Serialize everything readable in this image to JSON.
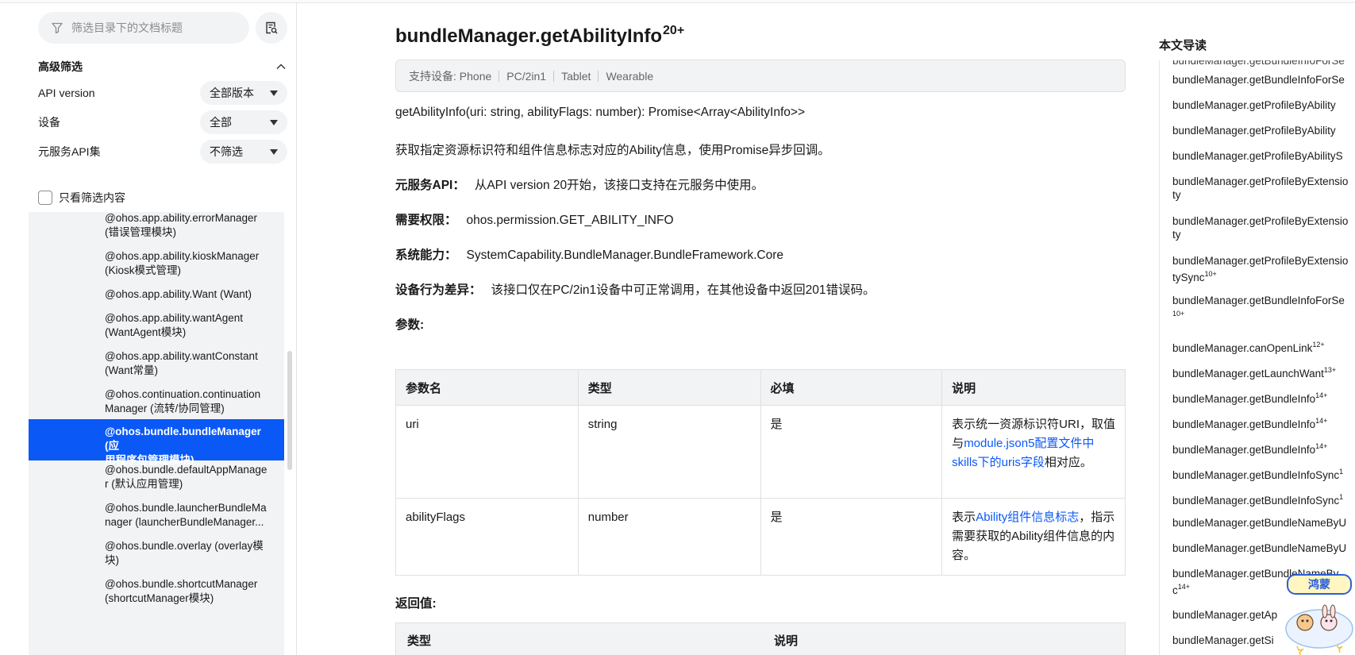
{
  "sidebar": {
    "search_placeholder": "筛选目录下的文档标题",
    "advanced_filter_title": "高级筛选",
    "filters": [
      {
        "label": "API version",
        "value": "全部版本"
      },
      {
        "label": "设备",
        "value": "全部"
      },
      {
        "label": "元服务API集",
        "value": "不筛选"
      }
    ],
    "only_filtered_label": "只看筛选内容",
    "tree": [
      {
        "line1": "@ohos.app.ability.errorManager",
        "line2": "(错误管理模块)"
      },
      {
        "line1": "@ohos.app.ability.kioskManager",
        "line2": "(Kiosk模式管理)"
      },
      {
        "line1": "@ohos.app.ability.Want (Want)",
        "line2": ""
      },
      {
        "line1": "@ohos.app.ability.wantAgent",
        "line2": "(WantAgent模块)"
      },
      {
        "line1": "@ohos.app.ability.wantConstant",
        "line2": "(Want常量)"
      },
      {
        "line1": "@ohos.continuation.continuation",
        "line2": "Manager (流转/协同管理)"
      },
      {
        "line1": "@ohos.bundle.bundleManager (应",
        "line2": "用程序包管理模块)"
      },
      {
        "line1": "@ohos.bundle.defaultAppManage",
        "line2": "r (默认应用管理)"
      },
      {
        "line1": "@ohos.bundle.launcherBundleMa",
        "line2": "nager (launcherBundleManager..."
      },
      {
        "line1": "@ohos.bundle.overlay (overlay模",
        "line2": "块)"
      },
      {
        "line1": "@ohos.bundle.shortcutManager",
        "line2": "(shortcutManager模块)"
      }
    ]
  },
  "main": {
    "title": "bundleManager.getAbilityInfo",
    "title_sup": "20+",
    "device_label": "支持设备: Phone",
    "devices_rest": [
      "PC/2in1",
      "Tablet",
      "Wearable"
    ],
    "signature": "getAbilityInfo(uri: string, abilityFlags: number): Promise<Array<AbilityInfo>>",
    "description": "获取指定资源标识符和组件信息标志对应的Ability信息，使用Promise异步回调。",
    "atomic_label": "元服务API：",
    "atomic_text": "从API version 20开始，该接口支持在元服务中使用。",
    "permission_label": "需要权限：",
    "permission_text": "ohos.permission.GET_ABILITY_INFO",
    "syscap_label": "系统能力：",
    "syscap_text": "SystemCapability.BundleManager.BundleFramework.Core",
    "diff_label": "设备行为差异：",
    "diff_text": "该接口仅在PC/2in1设备中可正常调用，在其他设备中返回201错误码。",
    "params_heading": "参数:",
    "params_headers": [
      "参数名",
      "类型",
      "必填",
      "说明"
    ],
    "params_rows": [
      {
        "name": "uri",
        "type": "string",
        "required": "是",
        "desc_pre": "表示统一资源标识符URI，取值与",
        "desc_link": "module.json5配置文件中skills下的uris字段",
        "desc_post": "相对应。"
      },
      {
        "name": "abilityFlags",
        "type": "number",
        "required": "是",
        "desc_pre": "表示",
        "desc_link": "Ability组件信息标志",
        "desc_post": "，指示需要获取的Ability组件信息的内容。"
      }
    ],
    "return_heading": "返回值:",
    "return_headers": [
      "类型",
      "说明"
    ]
  },
  "toc": {
    "title": "本文导读",
    "items": [
      {
        "text": "bundleManager.getBundleInfoForSe",
        "sup": ""
      },
      {
        "text": "bundleManager.getProfileByAbility",
        "sup": ""
      },
      {
        "text": "bundleManager.getProfileByAbility",
        "sup": ""
      },
      {
        "text": "bundleManager.getProfileByAbilityS",
        "sup": ""
      },
      {
        "text": "bundleManager.getProfileByExtensio",
        "text2": "ty",
        "sup": ""
      },
      {
        "text": "bundleManager.getProfileByExtensio",
        "text2": "ty",
        "sup": ""
      },
      {
        "text": "bundleManager.getProfileByExtensio",
        "text2": "tySync",
        "sup": "10+"
      },
      {
        "text": "bundleManager.getBundleInfoForSe",
        "text2": "",
        "sup": "10+"
      },
      {
        "text": "bundleManager.canOpenLink",
        "sup": "12+"
      },
      {
        "text": "bundleManager.getLaunchWant",
        "sup": "13+"
      },
      {
        "text": "bundleManager.getBundleInfo",
        "sup": "14+"
      },
      {
        "text": "bundleManager.getBundleInfo",
        "sup": "14+"
      },
      {
        "text": "bundleManager.getBundleInfo",
        "sup": "14+"
      },
      {
        "text": "bundleManager.getBundleInfoSync",
        "sup": "1"
      },
      {
        "text": "bundleManager.getBundleInfoSync",
        "sup": "1"
      },
      {
        "text": "bundleManager.getBundleNameByU",
        "sup": ""
      },
      {
        "text": "bundleManager.getBundleNameByU",
        "sup": ""
      },
      {
        "text": "bundleManager.getBundleNameBy",
        "text2": "c",
        "sup": "14+"
      },
      {
        "text": "bundleManager.getAp",
        "sup": ""
      },
      {
        "text": "bundleManager.getSi",
        "sup": ""
      }
    ]
  },
  "colors": {
    "accent": "#0a59f7",
    "panel_bg": "#f1f3f5",
    "text": "#191919"
  },
  "icons": {
    "search": "funnel-icon",
    "doc_search": "document-search-icon",
    "collapse": "chevron-up-icon",
    "dropdown": "triangle-down-icon",
    "mascot": "mascot-sticker"
  }
}
